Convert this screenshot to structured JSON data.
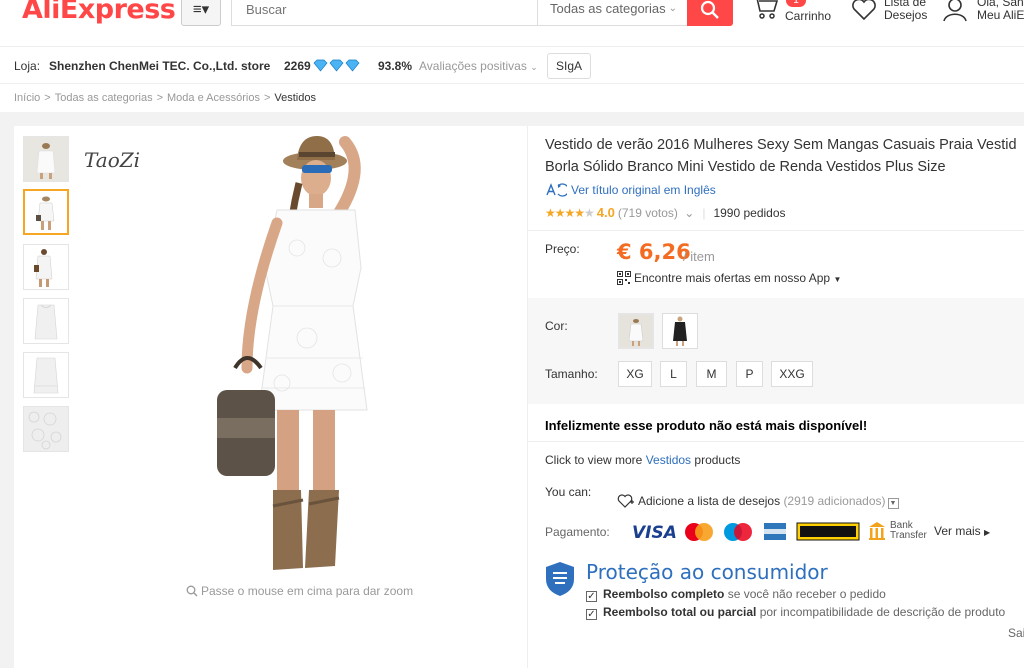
{
  "header": {
    "logo": "AliExpress",
    "menu_icon": "≡▾",
    "search_placeholder": "Buscar",
    "search_category": "Todas as categorias",
    "cart_count": "1",
    "cart_label": "Carrinho",
    "wishlist_label_1": "Lista de",
    "wishlist_label_2": "Desejos",
    "account_label_1": "Olá, Sand",
    "account_label_2": "Meu AliE"
  },
  "store": {
    "label": "Loja:",
    "name": "Shenzhen ChenMei TEC. Co.,Ltd. store",
    "score": "2269",
    "positive_pct": "93.8%",
    "feedback_label": "Avaliações positivas",
    "follow_label": "SIgA"
  },
  "breadcrumb": [
    "Início",
    "Todas as categorias",
    "Moda e Acessórios",
    "Vestidos"
  ],
  "gallery": {
    "brand": "TaoZi",
    "zoom_hint": "Passe o mouse em cima para dar zoom",
    "active_thumb": 1
  },
  "product": {
    "title_line1": "Vestido de verão 2016 Mulheres Sexy Sem Mangas Casuais Praia Vestid",
    "title_line2": "Borla Sólido Branco Mini Vestido de Renda Vestidos Plus Size",
    "translate_link": "Ver título original em Inglês",
    "rating": "4.0",
    "rating_stars_filled": 4,
    "votes": "(719 votos)",
    "orders": "1990 pedidos",
    "price_label": "Preço:",
    "price": "€ 6,26",
    "price_unit": "/ item",
    "app_offer": "Encontre mais ofertas em nosso App",
    "color_label": "Cor:",
    "size_label": "Tamanho:",
    "sizes": [
      "XG",
      "L",
      "M",
      "P",
      "XXG"
    ],
    "unavailable": "Infelizmente esse produto não está mais disponível!",
    "more_prefix": "Click to view more ",
    "more_link": "Vestidos",
    "more_suffix": " products",
    "youcan_label": "You can:",
    "wishlist_action": "Adicione a lista de desejos",
    "wishlist_count": "(2919 adicionados)",
    "payment_label": "Pagamento:",
    "payment_more": "Ver mais",
    "bank_transfer_1": "Bank",
    "bank_transfer_2": "Transfer"
  },
  "protection": {
    "title": "Proteção ao consumidor",
    "item1_bold": "Reembolso completo",
    "item1_rest": " se você não receber o pedido",
    "item2_bold": "Reembolso total ou parcial",
    "item2_rest": " por incompatibilidade de descrição de produto",
    "more": "Sai"
  },
  "colors": {
    "brand_red": "#ff4747",
    "price_orange": "#f36c21",
    "link_blue": "#2e6fbe",
    "star": "#f5a623"
  }
}
